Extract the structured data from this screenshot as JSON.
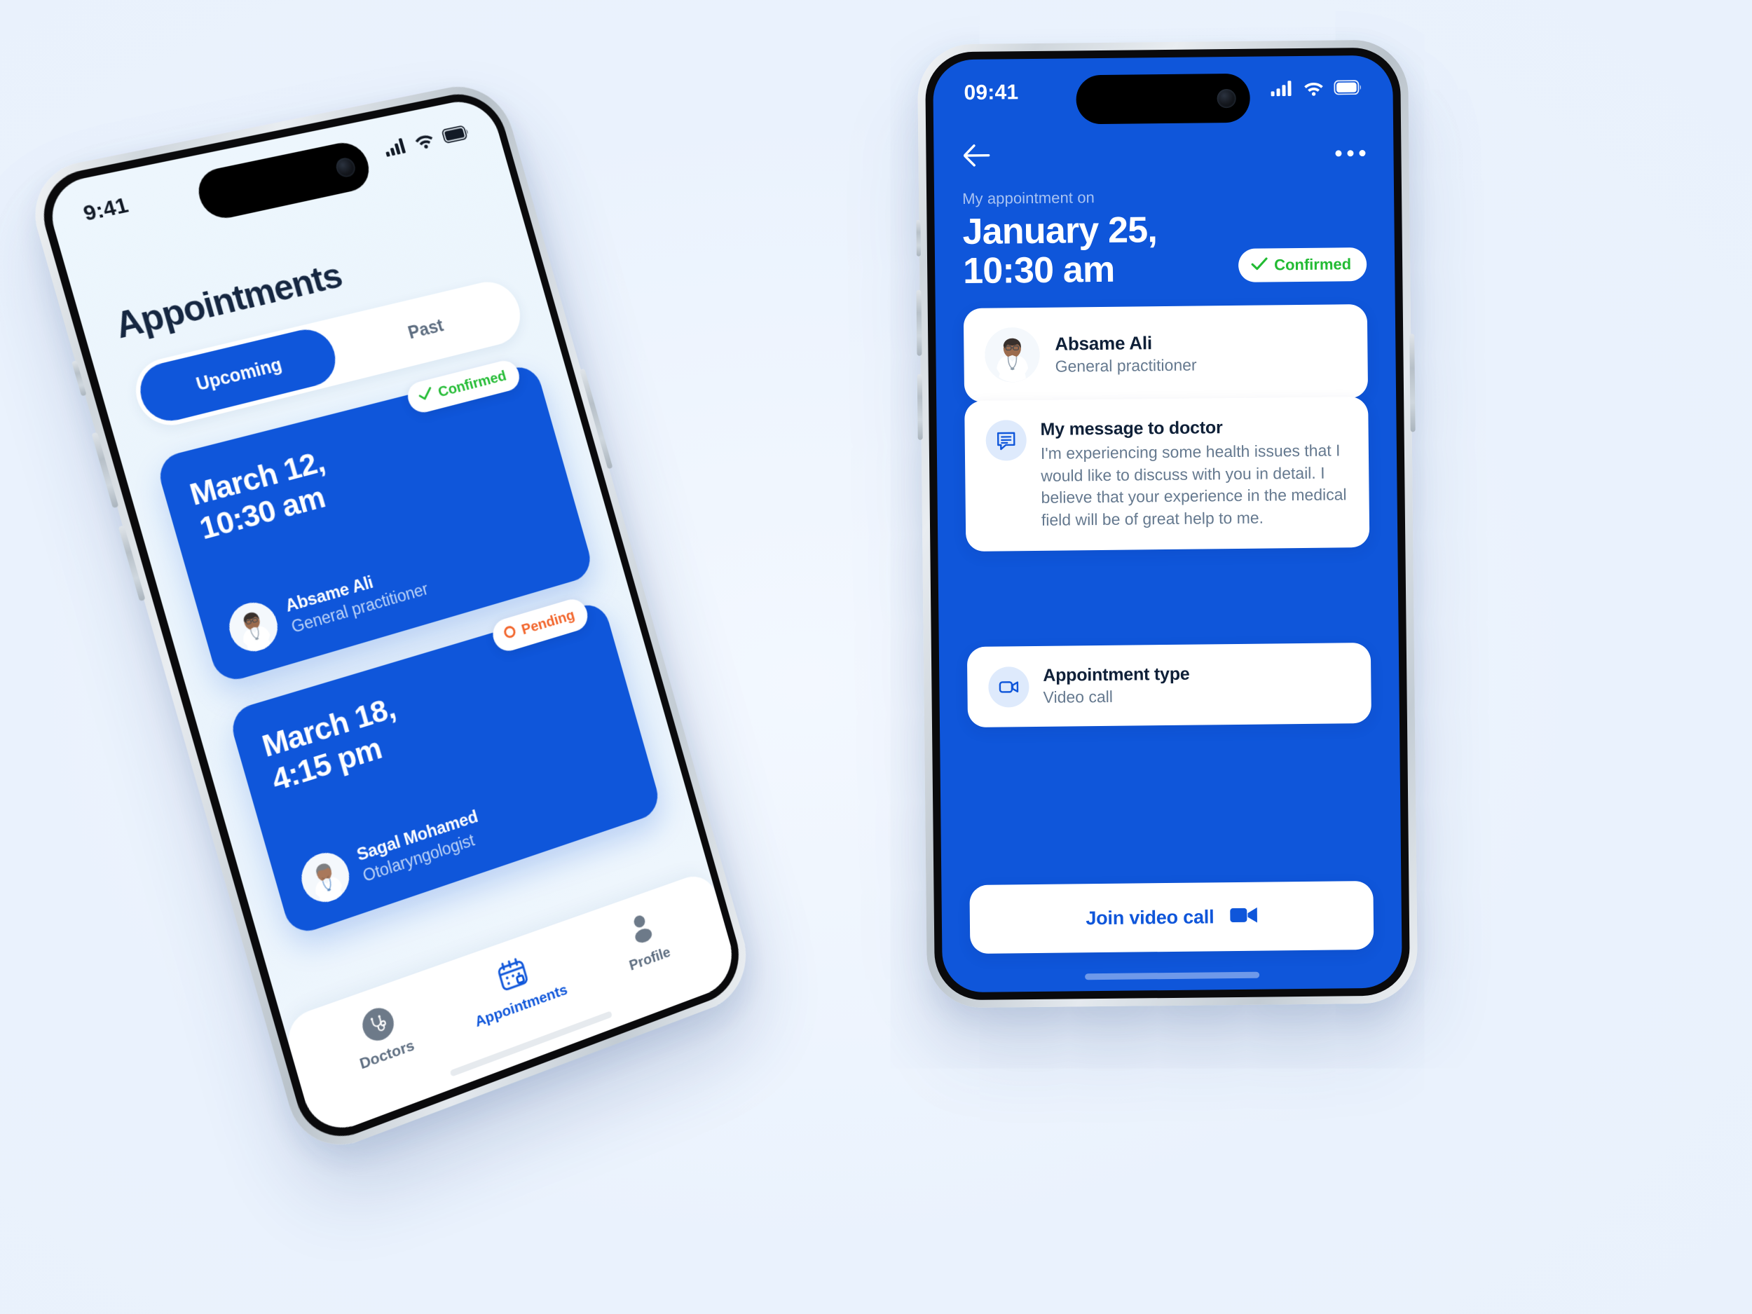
{
  "theme": {
    "page_background": "#eef4fd",
    "brand_blue": "#0f56da",
    "confirmed_green": "#22bb33",
    "pending_orange": "#f2642a",
    "card_white": "#ffffff",
    "muted_text": "#65798f"
  },
  "list_screen": {
    "status_bar": {
      "time": "9:41",
      "cellular_icon": "signal-bars-icon",
      "wifi_icon": "wifi-icon",
      "battery_icon": "battery-icon"
    },
    "page_title": "Appointments",
    "segmented_control": {
      "options": [
        "Upcoming",
        "Past"
      ],
      "selected": "Upcoming"
    },
    "appointments": [
      {
        "date": "March 12,",
        "time": "10:30 am",
        "status": "Confirmed",
        "status_type": "confirmed",
        "status_icon": "check-icon",
        "doctor_name": "Absame Ali",
        "doctor_role": "General practitioner"
      },
      {
        "date": "March 18,",
        "time": "4:15 pm",
        "status": "Pending",
        "status_type": "pending",
        "status_icon": "circle-outline-icon",
        "doctor_name": "Sagal Mohamed",
        "doctor_role": "Otolaryngologist"
      }
    ],
    "tab_bar": {
      "items": [
        {
          "label": "Doctors",
          "icon": "stethoscope-icon",
          "active": false
        },
        {
          "label": "Appointments",
          "icon": "calendar-icon",
          "active": true
        },
        {
          "label": "Profile",
          "icon": "person-icon",
          "active": false
        }
      ]
    }
  },
  "detail_screen": {
    "status_bar": {
      "time": "09:41",
      "cellular_icon": "signal-bars-icon",
      "wifi_icon": "wifi-icon",
      "battery_icon": "battery-icon"
    },
    "nav": {
      "back_icon": "back-arrow-icon",
      "more_icon": "more-options-icon"
    },
    "header": {
      "eyebrow": "My appointment on",
      "date_line1": "January 25,",
      "date_line2": "10:30 am",
      "status": "Confirmed",
      "status_icon": "check-icon"
    },
    "doctor_card": {
      "name": "Absame Ali",
      "role": "General practitioner",
      "avatar": "doctor-avatar"
    },
    "message_card": {
      "icon": "message-icon",
      "title": "My message to doctor",
      "body": "I'm experiencing some health issues that I would like to discuss with you in detail. I believe that your experience in the medical field will be of great help to me."
    },
    "type_card": {
      "icon": "video-camera-icon",
      "title": "Appointment type",
      "value": "Video call"
    },
    "join_button": {
      "label": "Join video call",
      "icon": "video-camera-icon"
    }
  }
}
